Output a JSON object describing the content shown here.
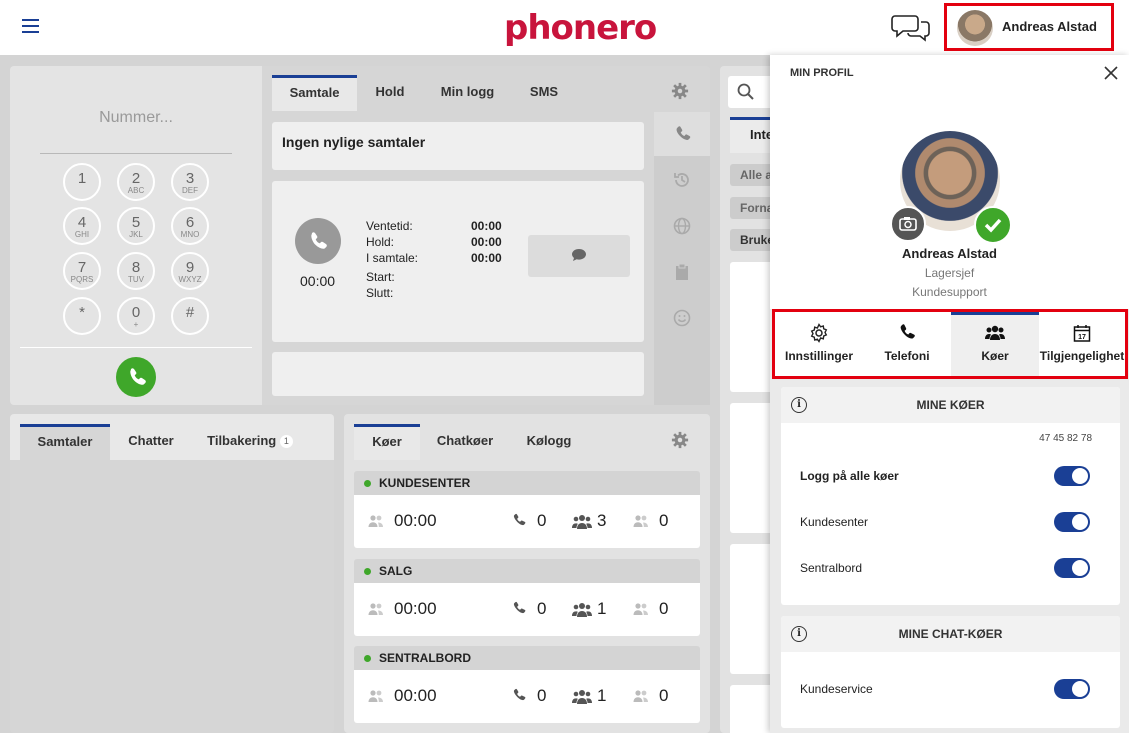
{
  "header": {
    "logo": "phonero",
    "user_name": "Andreas Alstad"
  },
  "dialer": {
    "placeholder": "Nummer...",
    "keys": [
      {
        "d": "1",
        "l": ""
      },
      {
        "d": "2",
        "l": "ABC"
      },
      {
        "d": "3",
        "l": "DEF"
      },
      {
        "d": "4",
        "l": "GHI"
      },
      {
        "d": "5",
        "l": "JKL"
      },
      {
        "d": "6",
        "l": "MNO"
      },
      {
        "d": "7",
        "l": "PQRS"
      },
      {
        "d": "8",
        "l": "TUV"
      },
      {
        "d": "9",
        "l": "WXYZ"
      },
      {
        "d": "*",
        "l": ""
      },
      {
        "d": "0",
        "l": "+"
      },
      {
        "d": "#",
        "l": ""
      }
    ]
  },
  "call_tabs": [
    "Samtale",
    "Hold",
    "Min logg",
    "SMS"
  ],
  "recent": "Ingen nylige samtaler",
  "call_stats": {
    "timer": "00:00",
    "labels": [
      "Ventetid:",
      "Hold:",
      "I samtale:",
      "Start:",
      "Slutt:"
    ],
    "values": [
      "00:00",
      "00:00",
      "00:00",
      "",
      ""
    ]
  },
  "bottom_left_tabs": [
    "Samtaler",
    "Chatter",
    "Tilbakering"
  ],
  "tilbakering_count": "1",
  "queue_tabs": [
    "Køer",
    "Chatkøer",
    "Kølogg"
  ],
  "queues": [
    {
      "name": "KUNDESENTER",
      "time": "00:00",
      "calls": "0",
      "agents": "3",
      "waiting": "0"
    },
    {
      "name": "SALG",
      "time": "00:00",
      "calls": "0",
      "agents": "1",
      "waiting": "0"
    },
    {
      "name": "SENTRALBORD",
      "time": "00:00",
      "calls": "0",
      "agents": "1",
      "waiting": "0"
    }
  ],
  "behind": {
    "tab": "Inte",
    "chips": [
      "Alle a",
      "Forna",
      "Bruke"
    ]
  },
  "profile": {
    "title": "MIN PROFIL",
    "name": "Andreas Alstad",
    "role": "Lagersjef",
    "department": "Kundesupport",
    "tabs": [
      "Innstillinger",
      "Telefoni",
      "Køer",
      "Tilgjengelighet"
    ],
    "my_queues": {
      "title": "MINE KØER",
      "number": "47 45 82 78",
      "rows": [
        "Logg på alle køer",
        "Kundesenter",
        "Sentralbord"
      ]
    },
    "my_chat_queues": {
      "title": "MINE CHAT-KØER",
      "rows": [
        "Kundeservice"
      ]
    }
  },
  "colors": {
    "brand_red": "#c8143c",
    "highlight_red": "#e3000f",
    "accent_blue": "#1a3f95",
    "green": "#3fa72a"
  }
}
